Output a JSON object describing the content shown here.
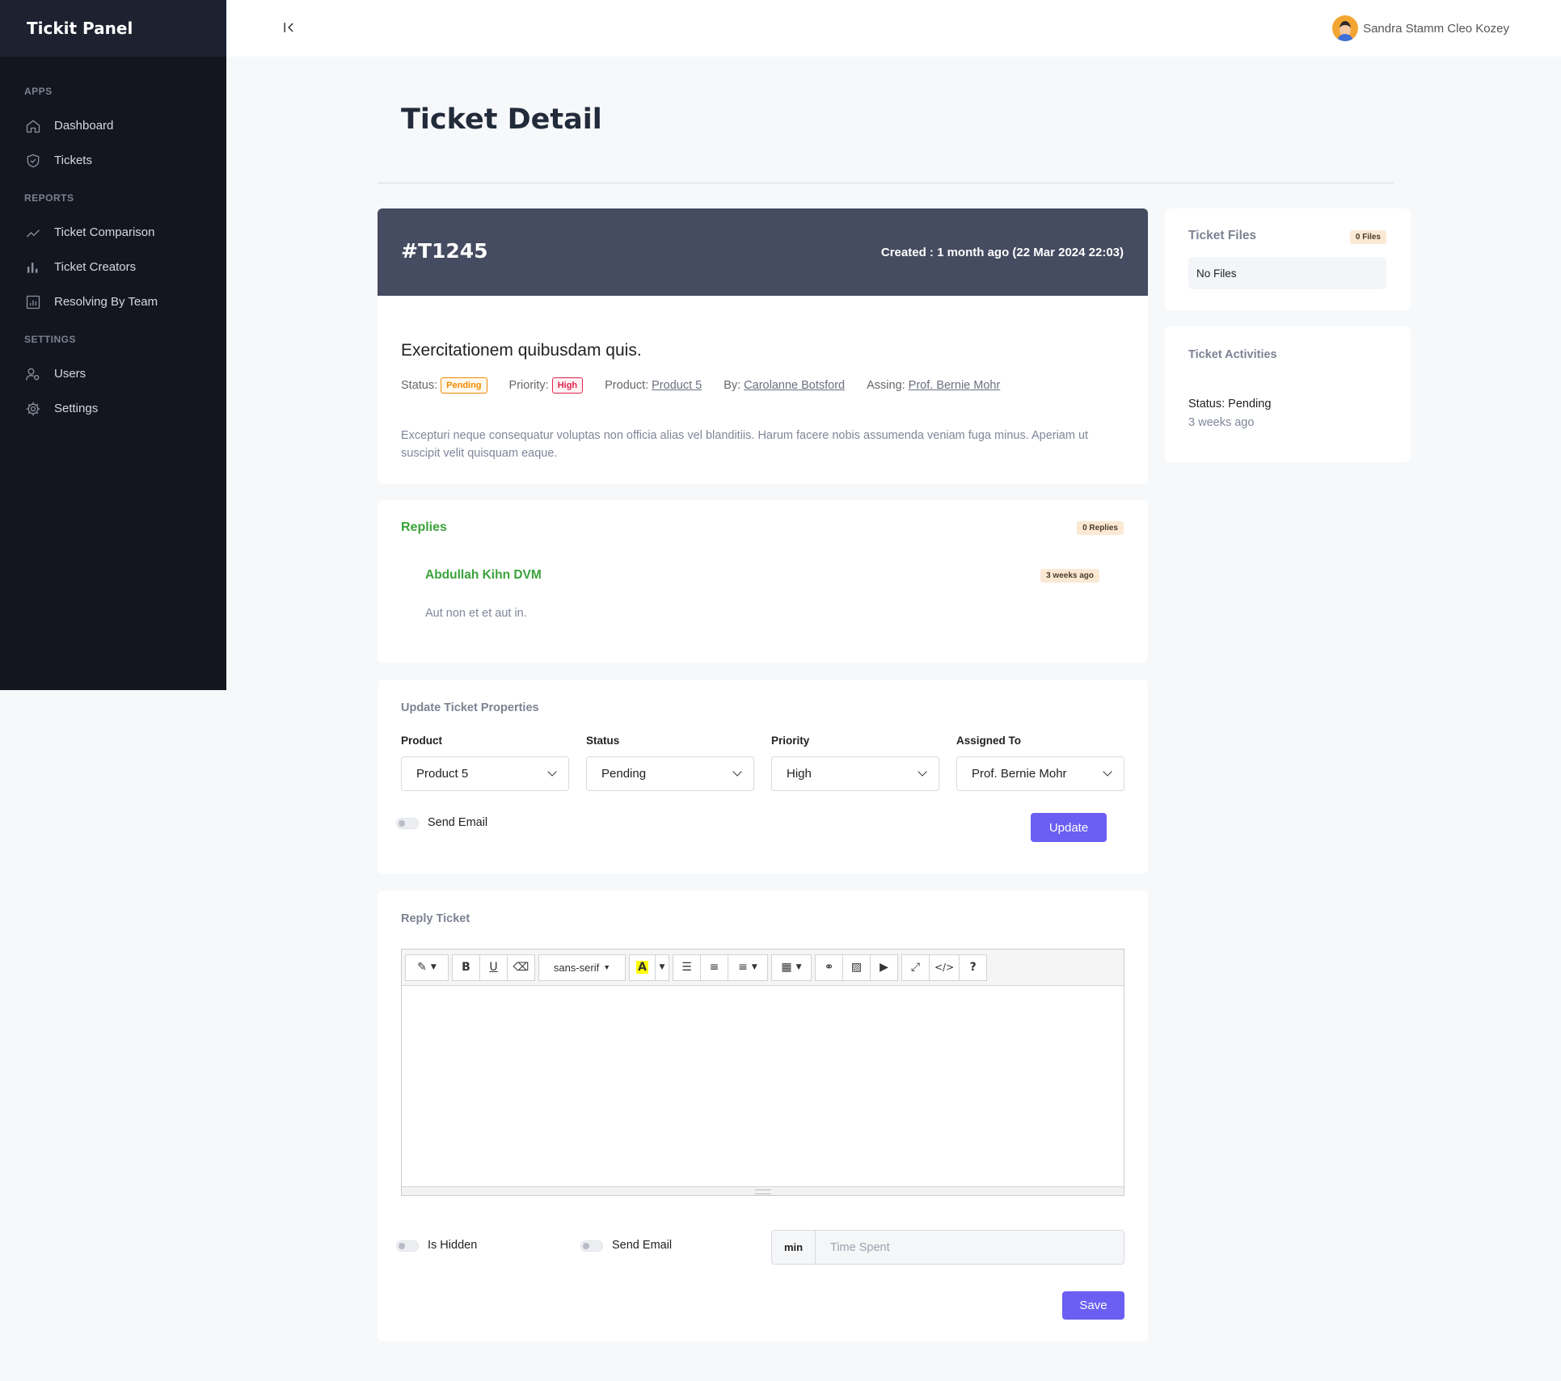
{
  "app": {
    "brand": "Tickit Panel"
  },
  "sidebar": {
    "sections": [
      {
        "title": "APPS",
        "items": [
          {
            "label": "Dashboard",
            "icon": "home-icon"
          },
          {
            "label": "Tickets",
            "icon": "shield-check-icon"
          }
        ]
      },
      {
        "title": "REPORTS",
        "items": [
          {
            "label": "Ticket Comparison",
            "icon": "trend-line-icon"
          },
          {
            "label": "Ticket Creators",
            "icon": "bar-chart-icon"
          },
          {
            "label": "Resolving By Team",
            "icon": "report-icon"
          }
        ]
      },
      {
        "title": "SETTINGS",
        "items": [
          {
            "label": "Users",
            "icon": "users-icon"
          },
          {
            "label": "Settings",
            "icon": "gear-icon"
          }
        ]
      }
    ]
  },
  "header": {
    "user_name": "Sandra Stamm Cleo Kozey"
  },
  "page": {
    "title": "Ticket Detail"
  },
  "ticket": {
    "id": "#T1245",
    "created": "Created : 1 month ago (22 Mar 2024 22:03)",
    "subject": "Exercitationem quibusdam quis.",
    "status_label": "Status:",
    "status": "Pending",
    "priority_label": "Priority:",
    "priority": "High",
    "product_label": "Product:",
    "product": "Product 5",
    "by_label": "By:",
    "by": "Carolanne Botsford",
    "assign_label": "Assing:",
    "assignee": "Prof. Bernie Mohr",
    "description": "Excepturi neque consequatur voluptas non officia alias vel blanditiis. Harum facere nobis assumenda veniam fuga minus. Aperiam ut suscipit velit quisquam eaque."
  },
  "replies": {
    "title": "Replies",
    "count": "0 Replies",
    "items": [
      {
        "author": "Abdullah Kihn DVM",
        "time": "3 weeks ago",
        "text": "Aut non et et aut in."
      }
    ]
  },
  "properties": {
    "title": "Update Ticket Properties",
    "fields": [
      {
        "label": "Product",
        "value": "Product 5"
      },
      {
        "label": "Status",
        "value": "Pending"
      },
      {
        "label": "Priority",
        "value": "High"
      },
      {
        "label": "Assigned To",
        "value": "Prof. Bernie Mohr"
      }
    ],
    "send_email": "Send Email",
    "update_button": "Update"
  },
  "reply_form": {
    "title": "Reply Ticket",
    "font": "sans-serif",
    "is_hidden": "Is Hidden",
    "send_email": "Send Email",
    "time_prefix": "min",
    "time_placeholder": "Time Spent",
    "save_button": "Save"
  },
  "files": {
    "title": "Ticket Files",
    "count": "0 Files",
    "empty": "No Files"
  },
  "activities": {
    "title": "Ticket Activities",
    "items": [
      {
        "status": "Status: Pending",
        "time": "3 weeks ago"
      }
    ]
  },
  "colors": {
    "sidebar": "#13161f",
    "brand_bar": "#1d2130",
    "ticket_header": "#454b60",
    "accent": "#6a5ff2",
    "reply_green": "#3aa33a",
    "pending": "#f08b00",
    "high": "#e0264f"
  }
}
